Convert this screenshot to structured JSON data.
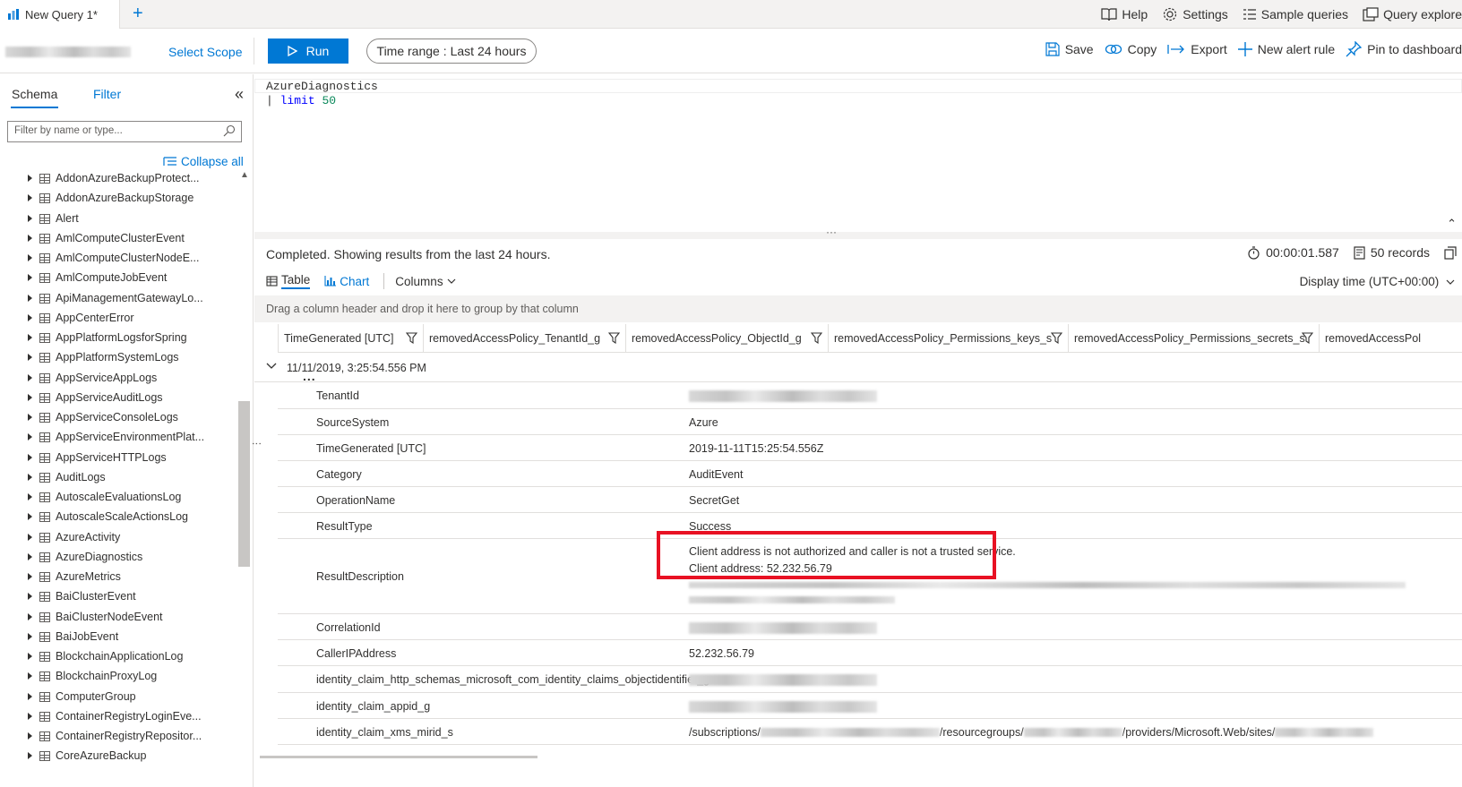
{
  "tab": {
    "title": "New Query 1*",
    "close": "×"
  },
  "new_tab": "+",
  "top_links": {
    "help": "Help",
    "settings": "Settings",
    "sample_queries": "Sample queries",
    "query_explorer": "Query explore"
  },
  "toolbar": {
    "select_scope": "Select Scope",
    "run": "Run",
    "time_range_label": "Time range :",
    "time_range_value": "Last 24 hours",
    "save": "Save",
    "copy": "Copy",
    "export": "Export",
    "new_alert_rule": "New alert rule",
    "pin": "Pin to dashboard"
  },
  "schema": {
    "tab_schema": "Schema",
    "tab_filter": "Filter",
    "collapse_icon": "«",
    "filter_placeholder": "Filter by name or type...",
    "collapse_all": "Collapse all",
    "tables": [
      "AddonAzureBackupProtect...",
      "AddonAzureBackupStorage",
      "Alert",
      "AmlComputeClusterEvent",
      "AmlComputeClusterNodeE...",
      "AmlComputeJobEvent",
      "ApiManagementGatewayLo...",
      "AppCenterError",
      "AppPlatformLogsforSpring",
      "AppPlatformSystemLogs",
      "AppServiceAppLogs",
      "AppServiceAuditLogs",
      "AppServiceConsoleLogs",
      "AppServiceEnvironmentPlat...",
      "AppServiceHTTPLogs",
      "AuditLogs",
      "AutoscaleEvaluationsLog",
      "AutoscaleScaleActionsLog",
      "AzureActivity",
      "AzureDiagnostics",
      "AzureMetrics",
      "BaiClusterEvent",
      "BaiClusterNodeEvent",
      "BaiJobEvent",
      "BlockchainApplicationLog",
      "BlockchainProxyLog",
      "ComputerGroup",
      "ContainerRegistryLoginEve...",
      "ContainerRegistryRepositor...",
      "CoreAzureBackup"
    ]
  },
  "editor": {
    "line1": "AzureDiagnostics",
    "line2_pipe": "| ",
    "line2_kw": "limit",
    "line2_num": "50"
  },
  "results": {
    "status": "Completed. Showing results from the last 24 hours.",
    "duration": "00:00:01.587",
    "records": "50 records",
    "tab_table": "Table",
    "tab_chart": "Chart",
    "columns": "Columns",
    "display_time": "Display time (UTC+00:00)",
    "group_hint": "Drag a column header and drop it here to group by that column",
    "column_headers": [
      "TimeGenerated [UTC]",
      "removedAccessPolicy_TenantId_g",
      "removedAccessPolicy_ObjectId_g",
      "removedAccessPolicy_Permissions_keys_s",
      "removedAccessPolicy_Permissions_secrets_s",
      "removedAccessPol"
    ],
    "group_row": "11/11/2019, 3:25:54.556 PM",
    "ellipsis": "...",
    "details": [
      {
        "key": "TenantId",
        "value": ""
      },
      {
        "key": "SourceSystem",
        "value": "Azure"
      },
      {
        "key": "TimeGenerated [UTC]",
        "value": "2019-11-11T15:25:54.556Z"
      },
      {
        "key": "Category",
        "value": "AuditEvent"
      },
      {
        "key": "OperationName",
        "value": "SecretGet"
      },
      {
        "key": "ResultType",
        "value": "Success"
      },
      {
        "key": "ResultDescription",
        "value": "Client address is not authorized and caller is not a trusted service.",
        "value2": "Client address: 52.232.56.79"
      },
      {
        "key": "CorrelationId",
        "value": ""
      },
      {
        "key": "CallerIPAddress",
        "value": "52.232.56.79"
      },
      {
        "key": "identity_claim_http_schemas_microsoft_com_identity_claims_objectidentifier_g",
        "value": ""
      },
      {
        "key": "identity_claim_appid_g",
        "value": ""
      },
      {
        "key": "identity_claim_xms_mirid_s",
        "value_parts": [
          "/subscriptions/",
          "/resourcegroups/",
          "/providers/Microsoft.Web/sites/"
        ]
      }
    ]
  },
  "colors": {
    "accent": "#0078d4",
    "highlight_box": "#e81123"
  }
}
